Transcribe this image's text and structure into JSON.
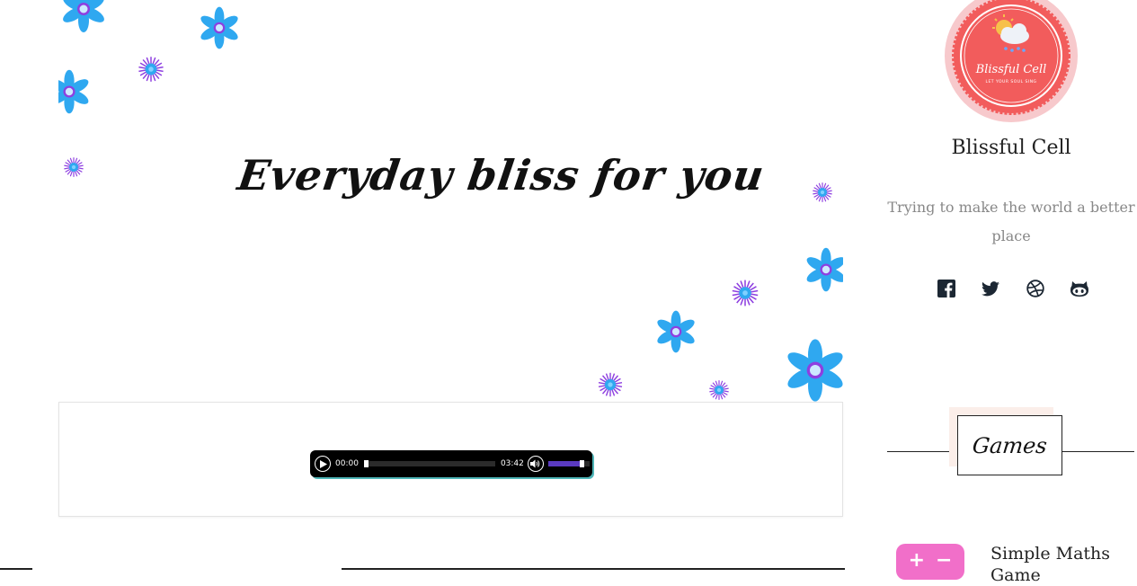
{
  "hero": {
    "title": "Everyday bliss for you"
  },
  "player": {
    "current_time": "00:00",
    "duration": "03:42",
    "progress": 0,
    "volume": 0.85
  },
  "sidebar": {
    "logo": {
      "text": "Blissful Cell",
      "subtext": "LET YOUR SOUL SING"
    },
    "site_name": "Blissful Cell",
    "tagline": "Trying to make the world a better place",
    "social": [
      {
        "name": "facebook-icon"
      },
      {
        "name": "twitter-icon"
      },
      {
        "name": "dribbble-icon"
      },
      {
        "name": "github-icon"
      }
    ],
    "section_title": "Games",
    "games": [
      {
        "title": "Simple Maths Game",
        "thumb_plus": "+",
        "thumb_minus": "−"
      }
    ]
  },
  "colors": {
    "flower_blue": "#2fa8f0",
    "flower_purple": "#8e3fe0",
    "logo_red": "#f25c5c",
    "logo_ring": "#f7c9cc",
    "player_accent": "#5a3ac0",
    "game_pink": "#f16fc9"
  }
}
